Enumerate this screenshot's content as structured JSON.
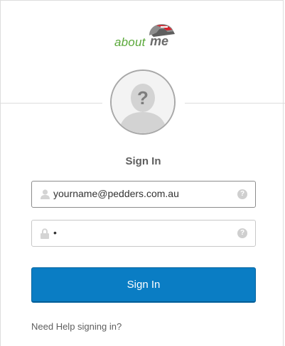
{
  "brand": {
    "about": "about",
    "me": "me",
    "accent": "#5aa83a"
  },
  "signin": {
    "title": "Sign In",
    "username": {
      "value": "yourname@pedders.com.au",
      "help": "?"
    },
    "password": {
      "value": "•",
      "help": "?"
    },
    "button": "Sign In",
    "help_link": "Need Help signing in?"
  },
  "colors": {
    "button": "#0a7dc4",
    "text": "#5e5e5e"
  }
}
